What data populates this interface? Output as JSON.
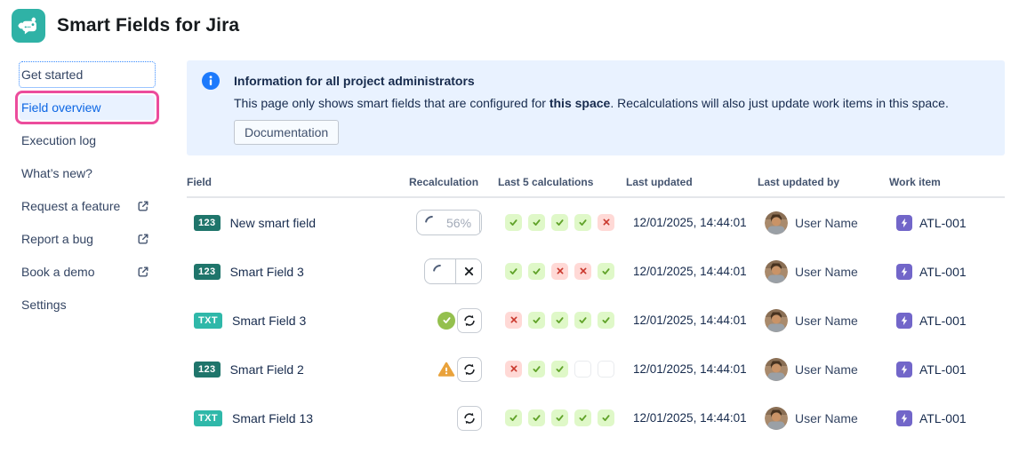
{
  "app": {
    "title": "Smart Fields for Jira"
  },
  "sidebar": {
    "items": [
      {
        "label": "Get started",
        "state": "focused",
        "external": false,
        "annotated": false
      },
      {
        "label": "Field overview",
        "state": "active",
        "external": false,
        "annotated": true
      },
      {
        "label": "Execution log",
        "state": "normal",
        "external": false,
        "annotated": false
      },
      {
        "label": "What’s new?",
        "state": "normal",
        "external": false,
        "annotated": false
      },
      {
        "label": "Request a feature",
        "state": "normal",
        "external": true,
        "annotated": false
      },
      {
        "label": "Report a bug",
        "state": "normal",
        "external": true,
        "annotated": false
      },
      {
        "label": "Book a demo",
        "state": "normal",
        "external": true,
        "annotated": false
      },
      {
        "label": "Settings",
        "state": "normal",
        "external": false,
        "annotated": false
      }
    ]
  },
  "banner": {
    "title": "Information for all project administrators",
    "body": [
      {
        "text": "This page only shows smart fields that are configured for ",
        "bold": false
      },
      {
        "text": "this space",
        "bold": true
      },
      {
        "text": ". Recalculations will also just update work items in this space.",
        "bold": false
      }
    ],
    "button": "Documentation"
  },
  "table": {
    "columns": [
      "Field",
      "Recalculation",
      "Last 5 calculations",
      "Last updated",
      "Last updated by",
      "Work item"
    ],
    "rows": [
      {
        "badge": "123",
        "badge_kind": "number",
        "name": "New smart field",
        "recalc": {
          "kind": "progress",
          "percent": "56%"
        },
        "last5": [
          "ok",
          "ok",
          "ok",
          "ok",
          "fail"
        ],
        "last_updated": "12/01/2025, 14:44:01",
        "last_updated_by": "User Name",
        "work_item": "ATL-001"
      },
      {
        "badge": "123",
        "badge_kind": "number",
        "name": "Smart Field 3",
        "recalc": {
          "kind": "progress",
          "percent": null
        },
        "last5": [
          "ok",
          "ok",
          "fail",
          "fail",
          "ok"
        ],
        "last_updated": "12/01/2025, 14:44:01",
        "last_updated_by": "User Name",
        "work_item": "ATL-001"
      },
      {
        "badge": "TXT",
        "badge_kind": "text",
        "name": "Smart Field 3",
        "recalc": {
          "kind": "idle",
          "status": "success"
        },
        "last5": [
          "fail",
          "ok",
          "ok",
          "ok",
          "ok"
        ],
        "last_updated": "12/01/2025, 14:44:01",
        "last_updated_by": "User Name",
        "work_item": "ATL-001"
      },
      {
        "badge": "123",
        "badge_kind": "number",
        "name": "Smart Field 2",
        "recalc": {
          "kind": "idle",
          "status": "warning"
        },
        "last5": [
          "fail",
          "ok",
          "ok",
          "empty",
          "empty"
        ],
        "last_updated": "12/01/2025, 14:44:01",
        "last_updated_by": "User Name",
        "work_item": "ATL-001"
      },
      {
        "badge": "TXT",
        "badge_kind": "text",
        "name": "Smart Field 13",
        "recalc": {
          "kind": "idle",
          "status": null
        },
        "last5": [
          "ok",
          "ok",
          "ok",
          "ok",
          "ok"
        ],
        "last_updated": "12/01/2025, 14:44:01",
        "last_updated_by": "User Name",
        "work_item": "ATL-001"
      }
    ]
  },
  "icons": {
    "logo": "robot-gear-icon",
    "banner": "info-icon",
    "sidebar_external": "external-link-icon",
    "recalc_cancel": "close-icon",
    "recalc_refresh": "refresh-icon",
    "work_item": "lightning-bolt-icon"
  },
  "colors": {
    "logo_teal": "#2FB2A6",
    "accent_blue": "#0C66E4",
    "active_bg": "#E9F2FF",
    "focus_ring": "#388BFF",
    "annotation_pink": "#EC4C9C",
    "banner_bg": "#E9F2FF",
    "info_blue": "#1D7AFC",
    "badge_number": "#1F756B",
    "badge_text": "#2FB8A9",
    "success_green": "#94C04E",
    "warning_orange": "#E9A23B",
    "work_item_purple": "#7266C9",
    "last5_ok_bg": "#DFF8C8",
    "last5_ok_glyph": "#61A32A",
    "last5_fail_bg": "#FFD9D6",
    "last5_fail_glyph": "#C9372C",
    "last5_empty_border": "#E9EBEE"
  }
}
